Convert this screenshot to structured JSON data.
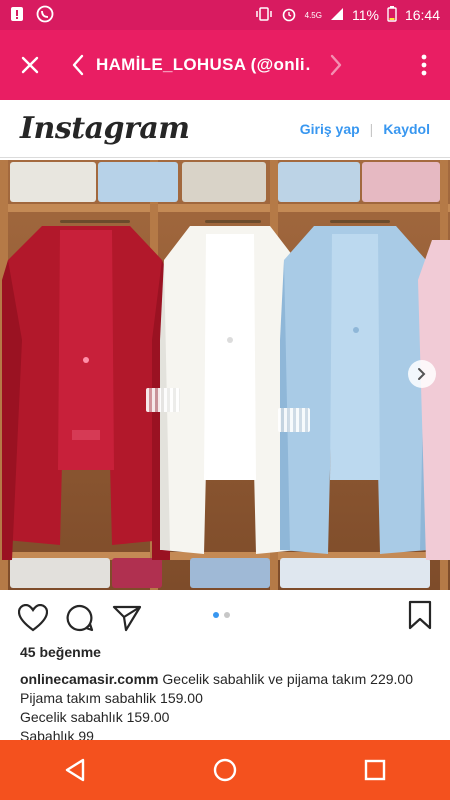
{
  "status": {
    "network": "4.5G",
    "battery": "11%",
    "time": "16:44"
  },
  "toolbar": {
    "title": "HAMİLE_LOHUSA (@onli…"
  },
  "instagram": {
    "logo": "Instagram",
    "login": "Giriş yap",
    "separator": "|",
    "signup": "Kaydol"
  },
  "post": {
    "likes": "45 beğenme",
    "username": "onlinecamasir.comm",
    "caption_line1": "Gecelik sabahlik ve pijama takım 229.00",
    "caption_line2": "Pijama takım sabahlik 159.00",
    "caption_line3": "Gecelik sabahlık 159.00",
    "caption_line4": "Sabahlık 99",
    "carousel_pages": 2,
    "carousel_current": 1
  },
  "colors": {
    "status_bar": "#d81b60",
    "app_bar": "#e91e63",
    "nav_bar": "#f4511e",
    "link_blue": "#3897f0"
  },
  "icons": {
    "close": "close-icon",
    "back": "chevron-left-icon",
    "forward": "chevron-right-icon",
    "menu": "more-vert-icon",
    "like": "heart-icon",
    "comment": "comment-icon",
    "share": "send-icon",
    "save": "bookmark-icon",
    "nav_back": "triangle-back-icon",
    "nav_home": "circle-home-icon",
    "nav_recent": "square-recent-icon"
  }
}
